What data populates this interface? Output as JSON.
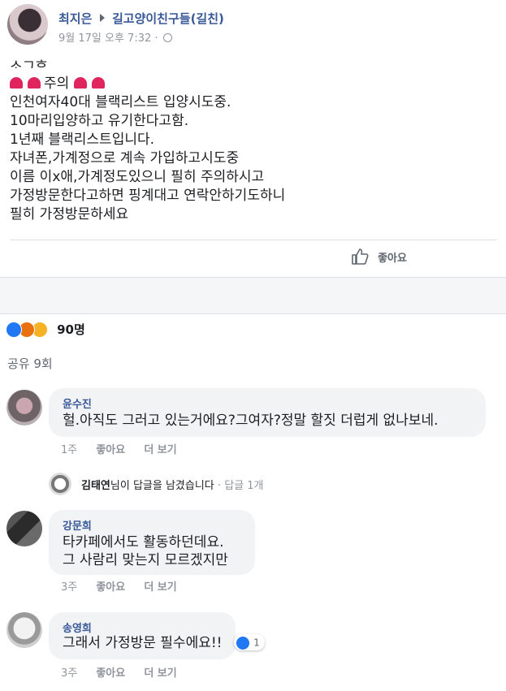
{
  "header": {
    "author": "최지은",
    "group": "길고양이친구들(길친)",
    "timestamp": "9월 17일 오후 7:32",
    "separator": "·",
    "privacy_icon": "globe-icon"
  },
  "post": {
    "cut_line": "소그후",
    "warning_line": "주의",
    "lines": [
      "인천여자40대 블랙리스트 입양시도중.",
      "10마리입양하고 유기한다고함.",
      "1년째 블랙리스트입니다.",
      "자녀폰,가계정으로 계속 가입하고시도중",
      "이름 이x애,가계정도있으니 필히 주의하시고",
      "가정방문한다고하면 핑계대고 연락안하기도하니",
      "필히 가정방문하세요"
    ]
  },
  "like_button": {
    "label": "좋아요",
    "icon": "thumbs-up-icon"
  },
  "reactions": {
    "count": "90명",
    "icons": [
      "like-icon",
      "angry-icon",
      "sad-icon"
    ]
  },
  "shares": "공유 9회",
  "comments": [
    {
      "name": "윤수진",
      "text_lines": [
        "헐.아직도 그러고 있는거에요?그여자?정말 할짓 더럽게 없나보네."
      ],
      "time": "1주",
      "like": "좋아요",
      "more": "더 보기"
    },
    {
      "name": "강문희",
      "text_lines": [
        "타카페에서도 활동하던데요.",
        "그 사람리 맞는지 모르겠지만"
      ],
      "time": "3주",
      "like": "좋아요",
      "more": "더 보기"
    },
    {
      "name": "송영희",
      "text_lines": [
        "그래서 가정방문 필수에요!!"
      ],
      "time": "3주",
      "like": "좋아요",
      "more": "더 보기",
      "reaction_count": "1"
    }
  ],
  "reply": {
    "name": "김태연",
    "suffix": "님이 답글을 남겼습니다",
    "separator": "·",
    "count": "답글 1개"
  },
  "colors": {
    "link": "#385898",
    "meta": "#90949c",
    "bubble": "#f2f3f5",
    "panel": "#f5f6f7",
    "like_blue": "#2078f4",
    "angry": "#e9710f",
    "sad": "#f7b125",
    "warning_red": "#e0245e"
  }
}
